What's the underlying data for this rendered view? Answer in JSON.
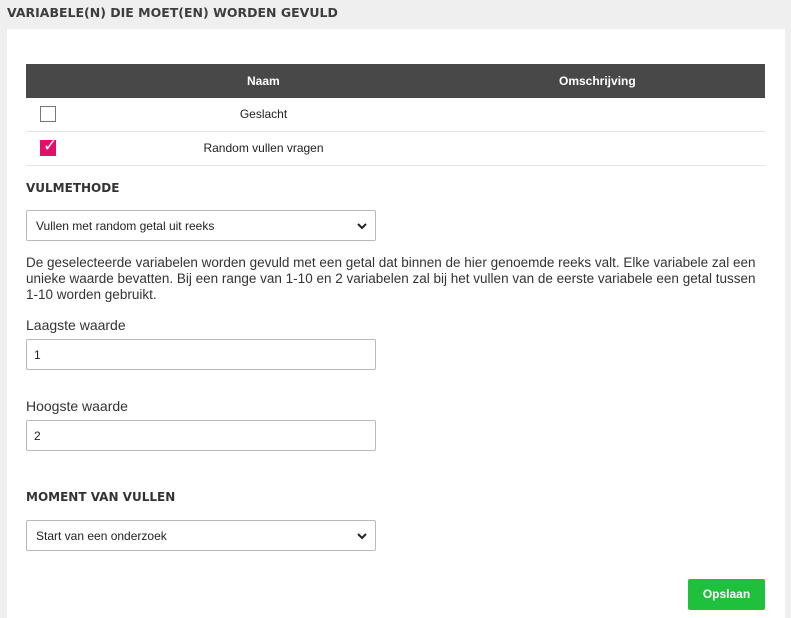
{
  "header": {
    "title": "VARIABELE(N) DIE MOET(EN) WORDEN GEVULD"
  },
  "table": {
    "columns": [
      "Naam",
      "Omschrijving"
    ],
    "rows": [
      {
        "checked": false,
        "naam": "Geslacht",
        "omschrijving": ""
      },
      {
        "checked": true,
        "naam": "Random vullen vragen",
        "omschrijving": ""
      }
    ]
  },
  "vulmethode": {
    "title": "VULMETHODE",
    "selected": "Vullen met random getal uit reeks",
    "description": "De geselecteerde variabelen worden gevuld met een getal dat binnen de hier genoemde reeks valt. Elke variabele zal een unieke waarde bevatten. Bij een range van 1-10 en 2 variabelen zal bij het vullen van de eerste variabele een getal tussen 1-10 worden gebruikt."
  },
  "laagste": {
    "label": "Laagste waarde",
    "value": "1"
  },
  "hoogste": {
    "label": "Hoogste waarde",
    "value": "2"
  },
  "moment": {
    "title": "MOMENT VAN VULLEN",
    "selected": "Start van een onderzoek"
  },
  "actions": {
    "save_label": "Opslaan"
  },
  "colors": {
    "accent_pink": "#e0106a",
    "save_green": "#1ec03c",
    "table_header": "#484848"
  }
}
